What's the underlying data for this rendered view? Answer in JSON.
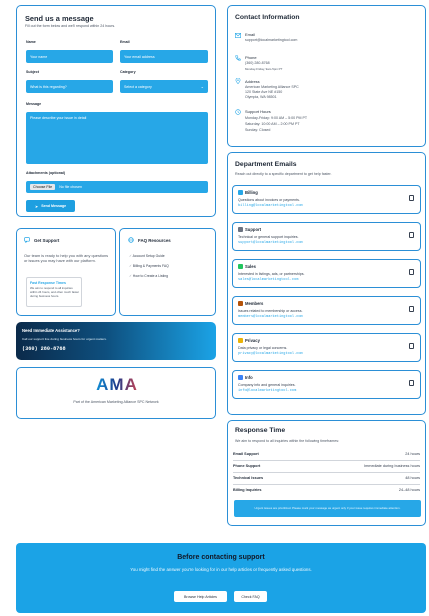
{
  "message_form": {
    "title": "Send us a message",
    "subtitle": "Fill out the form below and we'll respond within 24 hours.",
    "name_label": "Name",
    "name_placeholder": "Your name",
    "email_label": "Email",
    "email_placeholder": "Your email address",
    "subject_label": "Subject",
    "subject_placeholder": "What is this regarding?",
    "category_label": "Category",
    "category_value": "Select a category",
    "message_label": "Message",
    "message_placeholder": "Please describe your issue in detail",
    "attachments_label": "Attachments (optional)",
    "choose_file_button": "Choose File",
    "no_file": "No file chosen",
    "send_button": "Send Message"
  },
  "get_support": {
    "title": "Get Support",
    "text": "Our team is ready to help you with any questions or issues you may have with our platform.",
    "fast_title": "Fast Response Times",
    "fast_text": "We aim to respond to all inquiries within 24 hours, and often much faster during business hours."
  },
  "faq": {
    "title": "FAQ Resources",
    "items": [
      "Account Setup Guide",
      "Billing & Payments FAQ",
      "How to Create a Listing"
    ]
  },
  "immediate": {
    "title": "Need Immediate Assistance?",
    "text": "Call our support line during business hours for urgent matters.",
    "phone": "(360) 280-8768"
  },
  "ama": {
    "logo_text": "AMA",
    "caption": "Part of the American Marketing Alliance SPC Network"
  },
  "contact_info": {
    "title": "Contact Information",
    "email_label": "Email",
    "email_value": "support@localmarketingtool.com",
    "phone_label": "Phone",
    "phone_value": "(360) 280-8768",
    "phone_hours": "Monday-Friday, 9am-5pm PT",
    "address_label": "Address",
    "address_line1": "American Marketing Alliance SPC",
    "address_line2": "120 State Ave NE #150",
    "address_line3": "Olympia, WA 98501",
    "hours_label": "Support Hours",
    "hours_line1": "Monday-Friday: 9:00 AM – 5:00 PM PT",
    "hours_line2": "Saturday: 10:00 AM – 2:00 PM PT",
    "hours_line3": "Sunday: Closed"
  },
  "departments": {
    "title": "Department Emails",
    "subtitle": "Reach out directly to a specific department to get help faster.",
    "items": [
      {
        "name": "Billing",
        "desc": "Questions about invoices or payments.",
        "email": "billing@localmarketingtool.com",
        "icon": "billing-icon",
        "color": "#27a7e7"
      },
      {
        "name": "Support",
        "desc": "Technical or general support inquiries.",
        "email": "support@localmarketingtool.com",
        "icon": "tools-icon",
        "color": "#6b7280"
      },
      {
        "name": "Sales",
        "desc": "Interested in listings, ads, or partnerships.",
        "email": "sales@localmarketingtool.com",
        "icon": "dollar-icon",
        "color": "#22c55e"
      },
      {
        "name": "Members",
        "desc": "Issues related to membership or access.",
        "email": "members@localmarketingtool.com",
        "icon": "users-icon",
        "color": "#b45309"
      },
      {
        "name": "Privacy",
        "desc": "Data privacy or legal concerns.",
        "email": "privacy@localmarketingtool.com",
        "icon": "star-icon",
        "color": "#eab308"
      },
      {
        "name": "Info",
        "desc": "Company info and general inquiries.",
        "email": "info@localmarketingtool.com",
        "icon": "info-icon",
        "color": "#3b82f6"
      }
    ]
  },
  "response_time": {
    "title": "Response Time",
    "subtitle": "We aim to respond to all inquiries within the following timeframes:",
    "rows": [
      {
        "k": "Email Support",
        "v": "24 hours"
      },
      {
        "k": "Phone Support",
        "v": "Immediate during business hours"
      },
      {
        "k": "Technical Issues",
        "v": "48 hours"
      },
      {
        "k": "Billing Inquiries",
        "v": "24–48 hours"
      }
    ],
    "note": "Urgent issues are prioritized. Please mark your message as urgent only if your issue requires immediate attention."
  },
  "before": {
    "title": "Before contacting support",
    "text": "You might find the answer you're looking for in our help articles or frequently asked questions.",
    "help_button": "Browse Help Articles",
    "faq_button": "Check FAQ"
  },
  "colors": {
    "accent": "#27a7e7",
    "border": "#2b8fd6",
    "banner": "#1ba3e6"
  }
}
